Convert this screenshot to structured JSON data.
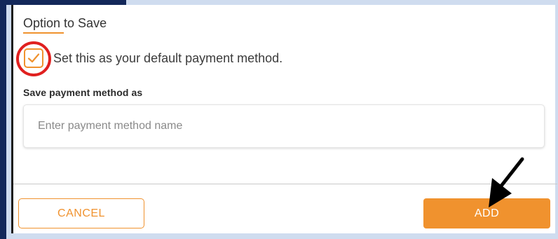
{
  "options": {
    "title": "Option to Save",
    "default_label": "Set this as your default payment method.",
    "default_checked": true
  },
  "save_as": {
    "label": "Save payment method as",
    "placeholder": "Enter payment method name",
    "value": ""
  },
  "actions": {
    "cancel_label": "CANCEL",
    "add_label": "ADD"
  },
  "colors": {
    "accent": "#f0922e",
    "annotation_circle": "#e0201f",
    "annotation_arrow": "#000000",
    "page_background": "#cfdcef",
    "nav_strip": "#13285a"
  },
  "icons": {
    "checkbox": "checkmark-icon",
    "annotation": "arrow-pointer-icon"
  }
}
